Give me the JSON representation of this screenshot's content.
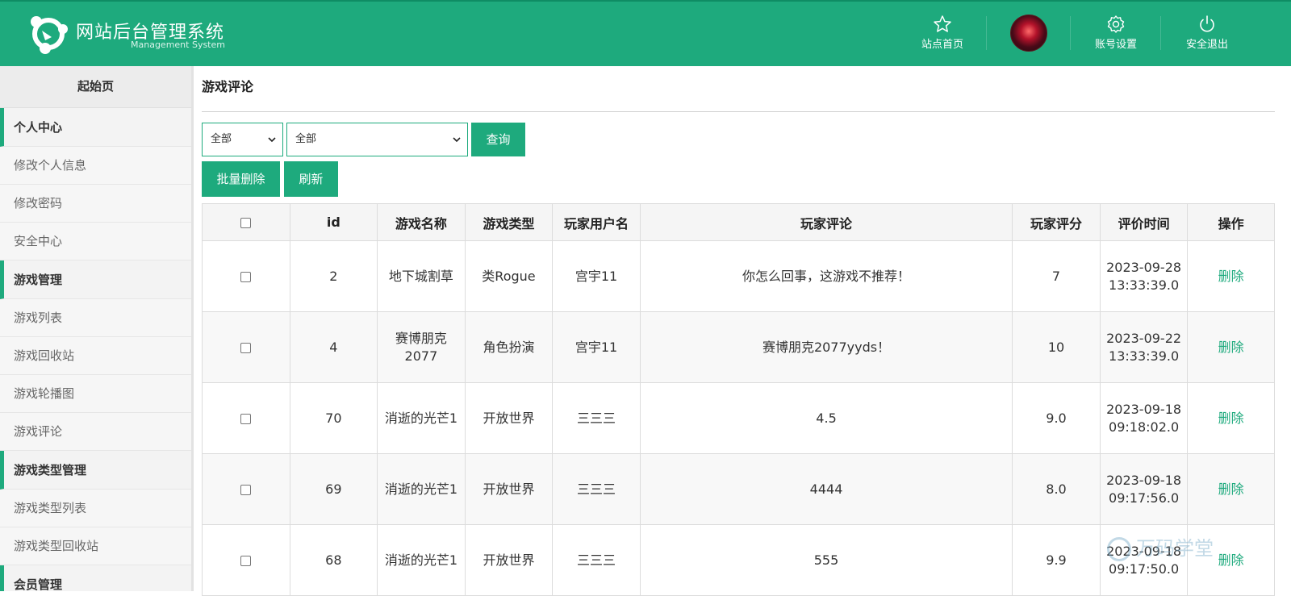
{
  "header": {
    "brand_title": "网站后台管理系统",
    "brand_subtitle": "Management System",
    "nav": {
      "home_label": "站点首页",
      "account_label": "账号设置",
      "logout_label": "安全退出"
    },
    "colors": {
      "primary": "#1eaa7d"
    }
  },
  "sidebar": {
    "home": "起始页",
    "group_personal": "个人中心",
    "item_edit_info": "修改个人信息",
    "item_edit_password": "修改密码",
    "item_security": "安全中心",
    "group_game": "游戏管理",
    "item_game_list": "游戏列表",
    "item_game_recycle": "游戏回收站",
    "item_game_carousel": "游戏轮播图",
    "item_game_comments": "游戏评论",
    "group_game_type": "游戏类型管理",
    "item_type_list": "游戏类型列表",
    "item_type_recycle": "游戏类型回收站",
    "group_member": "会员管理"
  },
  "main": {
    "page_title": "游戏评论",
    "filter": {
      "select1_value": "全部",
      "select2_value": "全部",
      "query_button": "查询"
    },
    "actions": {
      "batch_delete": "批量删除",
      "refresh": "刷新"
    },
    "table": {
      "headers": {
        "id": "id",
        "game_name": "游戏名称",
        "game_type": "游戏类型",
        "player_username": "玩家用户名",
        "player_comment": "玩家评论",
        "player_score": "玩家评分",
        "review_time": "评价时间",
        "operation": "操作"
      },
      "rows": [
        {
          "id": "2",
          "game_name": "地下城割草",
          "game_type": "类Rogue",
          "player_username": "宫宇11",
          "player_comment": "你怎么回事，这游戏不推荐！",
          "player_score": "7",
          "review_time": "2023-09-28 13:33:39.0",
          "operation": "删除"
        },
        {
          "id": "4",
          "game_name": "赛博朋克2077",
          "game_type": "角色扮演",
          "player_username": "宫宇11",
          "player_comment": "赛博朋克2077yyds！",
          "player_score": "10",
          "review_time": "2023-09-22 13:33:39.0",
          "operation": "删除"
        },
        {
          "id": "70",
          "game_name": "消逝的光芒1",
          "game_type": "开放世界",
          "player_username": "三三三",
          "player_comment": "4.5",
          "player_score": "9.0",
          "review_time": "2023-09-18 09:18:02.0",
          "operation": "删除"
        },
        {
          "id": "69",
          "game_name": "消逝的光芒1",
          "game_type": "开放世界",
          "player_username": "三三三",
          "player_comment": "4444",
          "player_score": "8.0",
          "review_time": "2023-09-18 09:17:56.0",
          "operation": "删除"
        },
        {
          "id": "68",
          "game_name": "消逝的光芒1",
          "game_type": "开放世界",
          "player_username": "三三三",
          "player_comment": "555",
          "player_score": "9.9",
          "review_time": "2023-09-18 09:17:50.0",
          "operation": "删除"
        }
      ]
    }
  },
  "watermark": "万码学堂"
}
